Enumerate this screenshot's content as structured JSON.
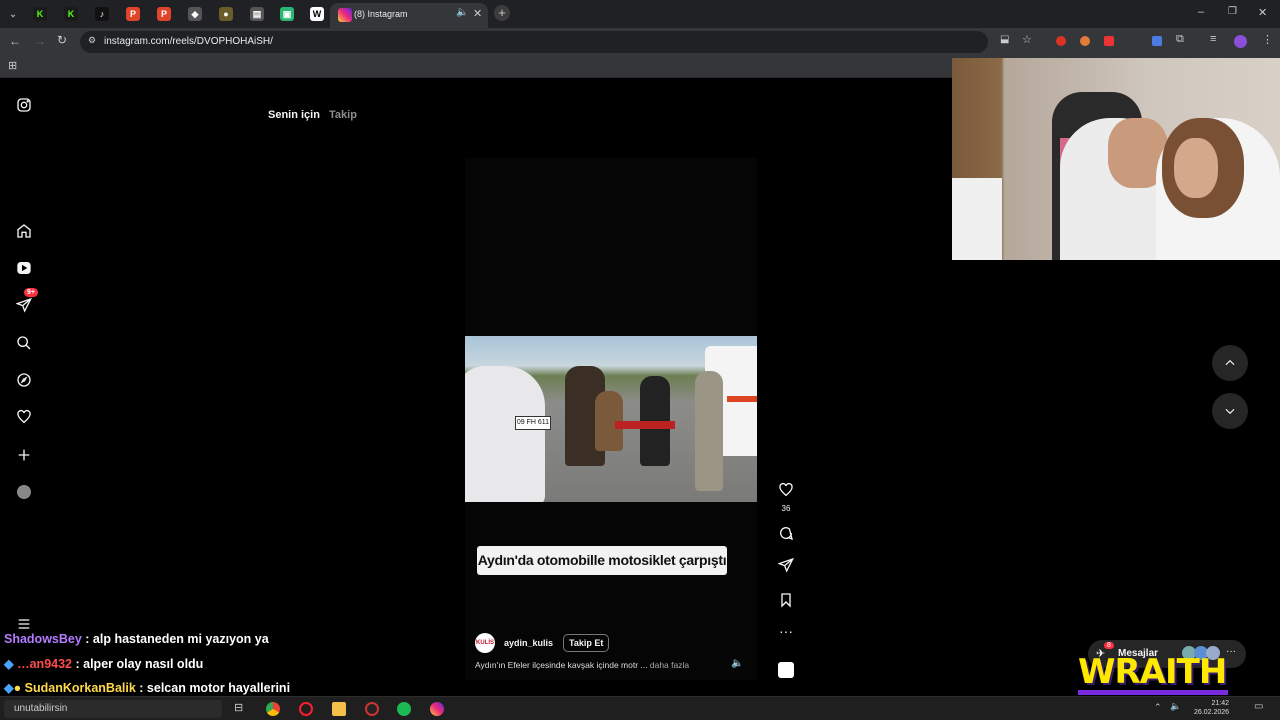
{
  "browser": {
    "active_tab_title": "(8) Instagram",
    "url": "instagram.com/reels/DVOPHOHAiSH/"
  },
  "instagram": {
    "feed_tabs": [
      "Senin için",
      "Takip"
    ],
    "notification_badge": "9+",
    "reel": {
      "caption_overlay": "Aydın'da otomobille motosiklet çarpıştı",
      "author": "aydin_kulis",
      "author_avatar_text": "KULİS",
      "follow_label": "Takip Et",
      "description": "Aydın'ın Efeler ilçesinde kavşak içinde motr ...",
      "more_label": "daha fazla",
      "like_count": "36",
      "plate_text": "09 FH 611"
    },
    "messages": {
      "label": "Mesajlar",
      "badge": "8"
    }
  },
  "overlay": {
    "brand": "WRAITH",
    "chat": [
      {
        "user": "ShadowsBey",
        "message": ": alp hastaneden mi yazıyon ya",
        "color": "#b57cff"
      },
      {
        "user": "…an9432",
        "message": ": alper olay nasıl oldu",
        "color": "#ff4d4d"
      },
      {
        "user": "SudanKorkanBalik",
        "message": ": selcan motor hayallerini",
        "color": "#ffd84d"
      }
    ]
  },
  "taskbar": {
    "search_text": "unutabilirsin",
    "time": "21:42",
    "date": "26.02.2026"
  }
}
